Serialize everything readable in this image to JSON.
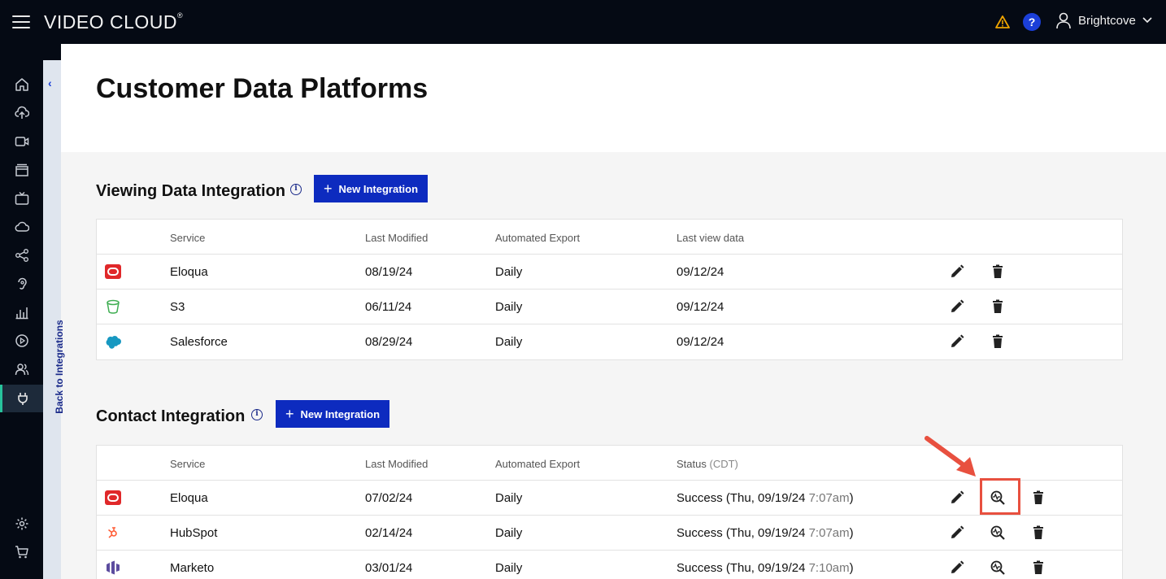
{
  "topbar": {
    "brand": "VIDEO CLOUD",
    "brand_mark": "®",
    "help": "?",
    "user": "Brightcove",
    "colors": {
      "bg": "#050a14",
      "warning": "#f0a500",
      "help": "#1b3fd8"
    }
  },
  "rail": {
    "items": [
      "home-icon",
      "upload-icon",
      "video-icon",
      "media-icon",
      "live-icon",
      "cloud-icon",
      "share-icon",
      "ear-icon",
      "analytics-icon",
      "player-icon",
      "users-icon",
      "plug-icon",
      "gear-icon",
      "cart-icon"
    ],
    "active": "plug-icon"
  },
  "back_link": {
    "label": "Back to Integrations"
  },
  "page": {
    "title": "Customer Data Platforms"
  },
  "viewing": {
    "title": "Viewing Data Integration",
    "new_button": "New Integration",
    "columns": [
      "Service",
      "Last Modified",
      "Automated Export",
      "Last view data"
    ],
    "rows": [
      {
        "logo": "oracle-logo",
        "service": "Eloqua",
        "modified": "08/19/24",
        "export": "Daily",
        "last": "09/12/24"
      },
      {
        "logo": "s3-logo",
        "service": "S3",
        "modified": "06/11/24",
        "export": "Daily",
        "last": "09/12/24"
      },
      {
        "logo": "salesforce-logo",
        "service": "Salesforce",
        "modified": "08/29/24",
        "export": "Daily",
        "last": "09/12/24"
      }
    ]
  },
  "contact": {
    "title": "Contact Integration",
    "new_button": "New Integration",
    "columns": [
      "Service",
      "Last Modified",
      "Automated Export",
      "Status",
      "(CDT)"
    ],
    "rows": [
      {
        "logo": "oracle-logo",
        "service": "Eloqua",
        "modified": "07/02/24",
        "export": "Daily",
        "status": "Success (Thu, 09/19/24 ",
        "time": "7:07am",
        "close": ")"
      },
      {
        "logo": "hubspot-logo",
        "service": "HubSpot",
        "modified": "02/14/24",
        "export": "Daily",
        "status": "Success (Thu, 09/19/24 ",
        "time": "7:07am",
        "close": ")"
      },
      {
        "logo": "marketo-logo",
        "service": "Marketo",
        "modified": "03/01/24",
        "export": "Daily",
        "status": "Success (Thu, 09/19/24 ",
        "time": "7:10am",
        "close": ")"
      }
    ]
  },
  "annotation": {
    "color": "#e8503f"
  }
}
